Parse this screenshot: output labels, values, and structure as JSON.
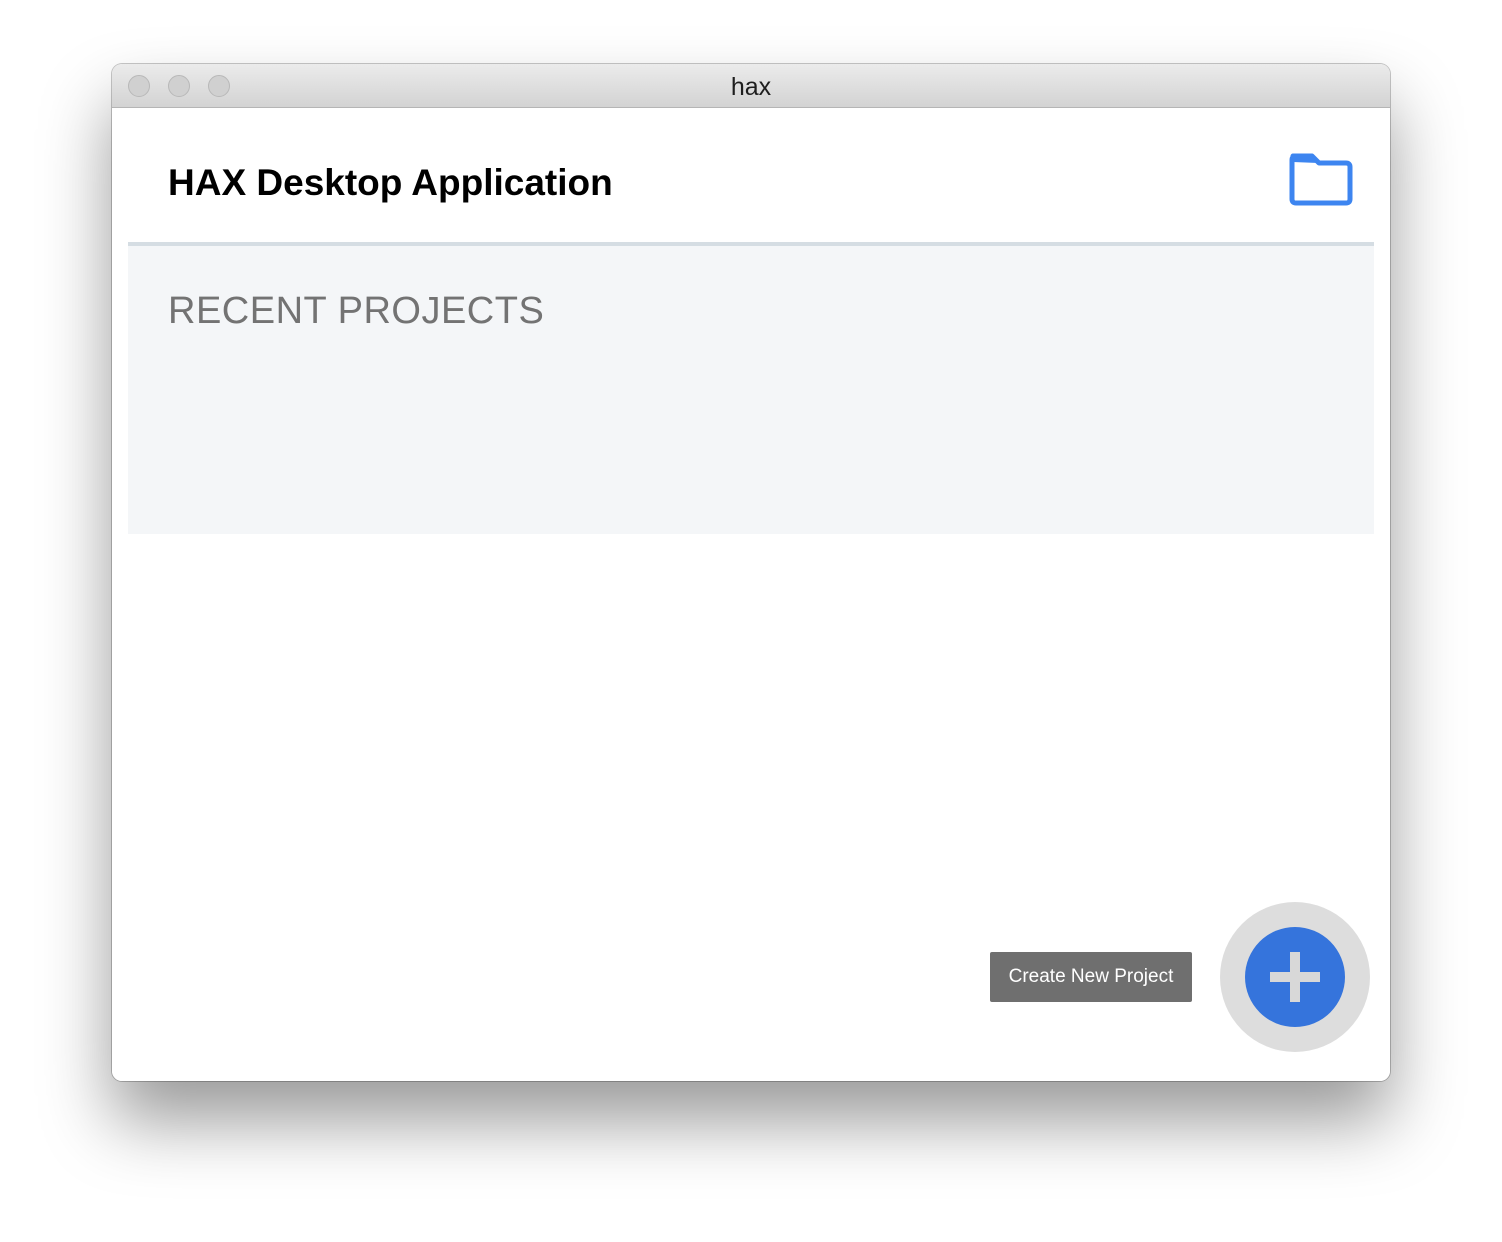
{
  "window": {
    "title": "hax"
  },
  "header": {
    "title": "HAX Desktop Application",
    "open_folder_icon": "folder-icon"
  },
  "recent_projects": {
    "heading": "RECENT PROJECTS",
    "items": []
  },
  "actions": {
    "create_tooltip": "Create New Project",
    "create_icon": "plus-icon"
  },
  "colors": {
    "accent": "#3574dc",
    "folder_icon": "#3d85f0",
    "recent_bg": "#f4f6f8",
    "divider": "#d5dde3",
    "tooltip_bg": "#6f6f6f"
  }
}
